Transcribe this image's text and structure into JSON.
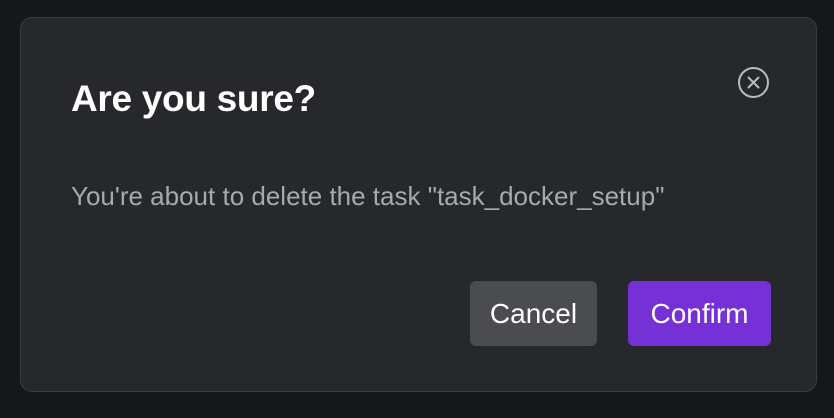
{
  "dialog": {
    "title": "Are you sure?",
    "message": "You're about to delete the task \"task_docker_setup\"",
    "close_icon": "close-circle-icon",
    "cancel_label": "Cancel",
    "confirm_label": "Confirm"
  },
  "colors": {
    "background": "#161718",
    "dialog_background": "#26282b",
    "cancel_button": "#4a4c50",
    "confirm_button": "#7631d6",
    "title_text": "#ffffff",
    "message_text": "#a6a9ae"
  }
}
